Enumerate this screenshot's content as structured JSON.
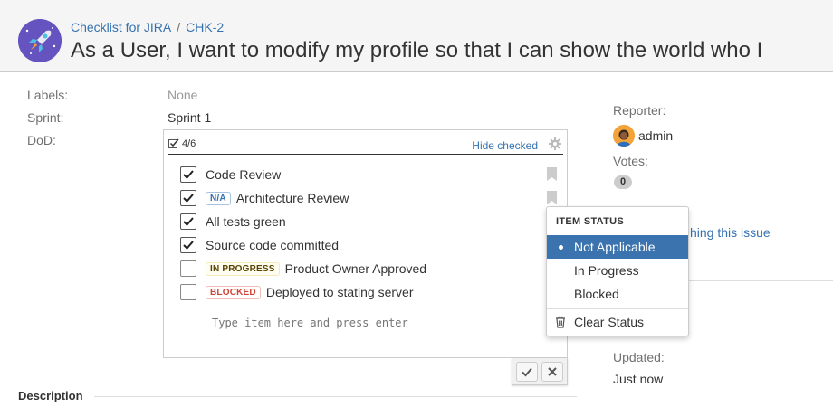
{
  "header": {
    "project_link": "Checklist for JIRA",
    "separator": "/",
    "issue_key": "CHK-2",
    "title": "As a User, I want to modify my profile so that I can show the world who I"
  },
  "fields": {
    "labels_label": "Labels:",
    "labels_value": "None",
    "sprint_label": "Sprint:",
    "sprint_value": "Sprint 1",
    "dod_label": "DoD:"
  },
  "checklist": {
    "progress": "4/6",
    "hide_checked": "Hide checked",
    "items": [
      {
        "label": "Code Review",
        "checked": true,
        "status": ""
      },
      {
        "label": "Architecture Review",
        "checked": true,
        "status": "N/A"
      },
      {
        "label": "All tests green",
        "checked": true,
        "status": ""
      },
      {
        "label": "Source code committed",
        "checked": true,
        "status": ""
      },
      {
        "label": "Product Owner Approved",
        "checked": false,
        "status": "IN PROGRESS"
      },
      {
        "label": "Deployed to stating server",
        "checked": false,
        "status": "BLOCKED"
      }
    ],
    "add_placeholder": "Type item here and press enter"
  },
  "people": {
    "reporter_label": "Reporter:",
    "reporter_name": "admin",
    "votes_label": "Votes:",
    "votes_count": "0",
    "watch_partial": "hing this issue"
  },
  "dates": {
    "updated_label": "Updated:",
    "updated_value": "Just now"
  },
  "description": {
    "heading": "Description"
  },
  "status_menu": {
    "heading": "ITEM STATUS",
    "options": [
      "Not Applicable",
      "In Progress",
      "Blocked"
    ],
    "selected": "Not Applicable",
    "clear": "Clear Status"
  },
  "colors": {
    "link": "#3572b0",
    "selected_bg": "#3b73af"
  }
}
